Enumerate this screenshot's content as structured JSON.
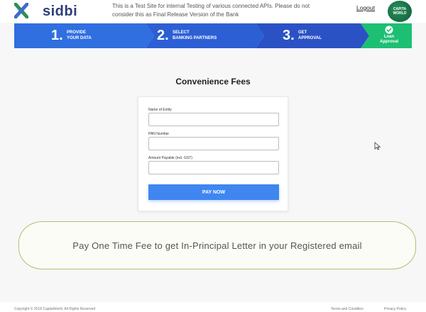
{
  "header": {
    "logo_text": "sidbi",
    "notice": "This is a Test Site for internal Testing of various connected APIs. Please do not consider this as Final Release Version of the Bank",
    "logout_label": "Logout",
    "partner_logo_text": "CAPITA WORLD"
  },
  "steps": [
    {
      "number": "1.",
      "line1": "PROVIDE",
      "line2": "YOUR DATA"
    },
    {
      "number": "2.",
      "line1": "SELECT",
      "line2": "BANKING PARTNERS"
    },
    {
      "number": "3.",
      "line1": "GET",
      "line2": "APPROVAL"
    },
    {
      "line1": "Loan",
      "line2": "Approval"
    }
  ],
  "main": {
    "title": "Convenience Fees",
    "fields": [
      {
        "label": "Name of Entity",
        "value": ""
      },
      {
        "label": "PAN Number",
        "value": ""
      },
      {
        "label": "Amount Payable (incl. GST)",
        "value": ""
      }
    ],
    "pay_label": "PAY NOW"
  },
  "banner": {
    "text": "Pay One Time Fee to get In-Principal Letter  in  your Registered email"
  },
  "footer": {
    "copyright": "Copyright © 2018 CapitaWorld. All Rights Reserved",
    "terms": "Terms and Condition",
    "privacy": "Privacy Policy"
  },
  "colors": {
    "step_blue_1": "#2f6fe0",
    "step_blue_2": "#2c5fd4",
    "step_blue_3": "#2a52c4",
    "step_green": "#1dbf73",
    "pay_button": "#3f86f0",
    "banner_border": "#a9c46b"
  }
}
